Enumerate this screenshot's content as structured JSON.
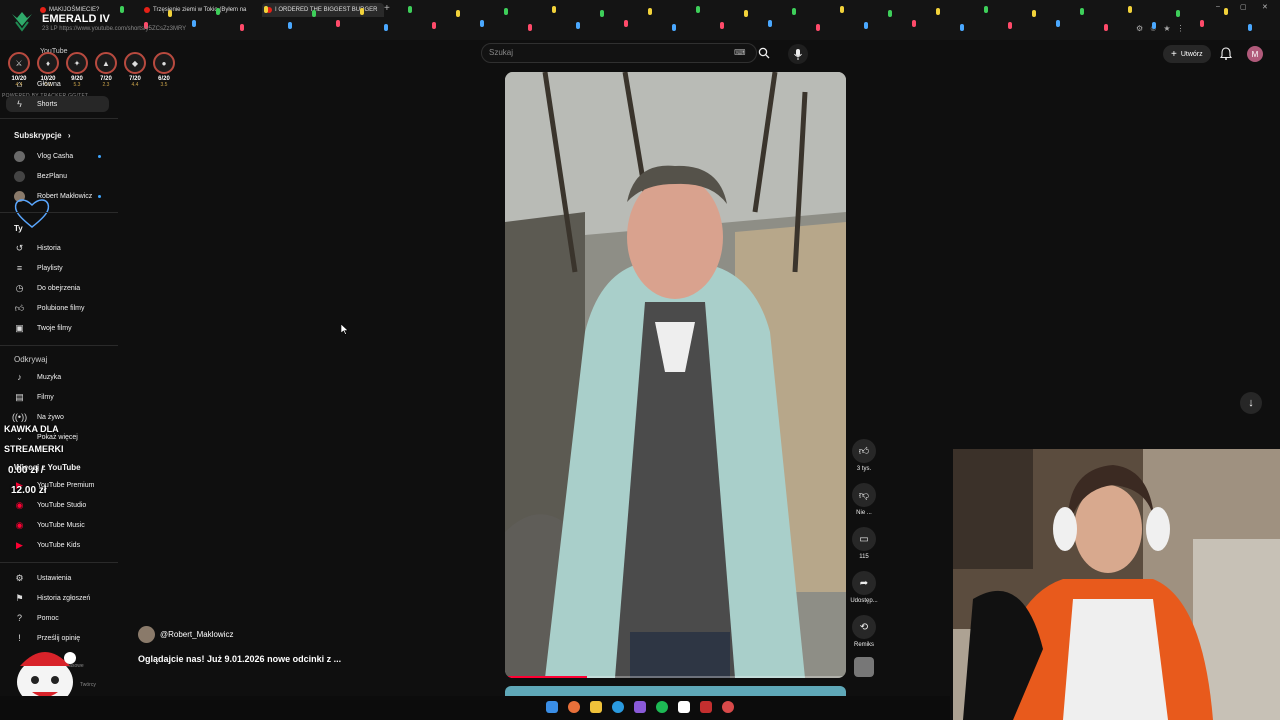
{
  "browser": {
    "tabs": [
      {
        "label": "MAKIJOŚMIECIE?"
      },
      {
        "label": "Trzęsienie ziemi w Tokio (Byłem na"
      },
      {
        "label": "I ORDERED THE BIGGEST BURGER"
      }
    ],
    "new_tab": "+",
    "address": "https://www.youtube.com/shorts/y5ZCsZz3MRY",
    "window_controls": [
      "–",
      "▢",
      "✕"
    ]
  },
  "overlay": {
    "rank_title": "EMERALD IV",
    "subtitle": "23 LP",
    "traits": [
      {
        "count": "10/20",
        "value": "4.4"
      },
      {
        "count": "10/20",
        "value": "5.2"
      },
      {
        "count": "9/20",
        "value": "5.3"
      },
      {
        "count": "7/20",
        "value": "2.3"
      },
      {
        "count": "7/20",
        "value": "4.4"
      },
      {
        "count": "6/20",
        "value": "3.5"
      }
    ],
    "powered_by": "POWERED BY TRACKER.GG/TFT",
    "kawka_line1": "KAWKA DLA",
    "kawka_line2": "STREAMERKI",
    "kawka_current": "0.00 zł /",
    "kawka_goal": "12.00 zł"
  },
  "header": {
    "logo_text": "YouTube",
    "search_placeholder": "Szukaj",
    "create_label": "Utwórz",
    "avatar_letter": "M"
  },
  "sidebar": {
    "top_items": [
      {
        "label": "Główna"
      },
      {
        "label": "Shorts"
      }
    ],
    "subscriptions_title": "Subskrypcje",
    "subscriptions": [
      {
        "label": "Vlog Casha"
      },
      {
        "label": "BezPlanu"
      },
      {
        "label": "Robert Makłowicz"
      }
    ],
    "you_title": "Ty",
    "you_items": [
      {
        "label": "Historia"
      },
      {
        "label": "Playlisty"
      },
      {
        "label": "Do obejrzenia"
      },
      {
        "label": "Polubione filmy"
      },
      {
        "label": "Twoje filmy"
      }
    ],
    "explore_title": "Odkrywaj",
    "explore_items": [
      {
        "label": "Muzyka"
      },
      {
        "label": "Filmy"
      },
      {
        "label": "Na żywo"
      },
      {
        "label": "Pokaż więcej"
      }
    ],
    "more_title": "Więcej z YouTube",
    "more_items": [
      {
        "label": "YouTube Premium"
      },
      {
        "label": "YouTube Studio"
      },
      {
        "label": "YouTube Music"
      },
      {
        "label": "YouTube Kids"
      }
    ],
    "bottom_items": [
      {
        "label": "Ustawienia"
      },
      {
        "label": "Historia zgłoszeń"
      },
      {
        "label": "Pomoc"
      },
      {
        "label": "Prześlij opinię"
      }
    ],
    "footer_text": "Informacje prasowe",
    "footer_text2": "Twórcy"
  },
  "short": {
    "channel": "@Robert_Maklowicz",
    "caption": "Oglądajcie nas! Już 9.01.2026 nowe odcinki z ...",
    "progress": 0.24,
    "actions": [
      {
        "icon": "thumb-up-icon",
        "label": "3 tys."
      },
      {
        "icon": "thumb-down-icon",
        "label": "Nie ..."
      },
      {
        "icon": "comment-icon",
        "label": "115"
      },
      {
        "icon": "share-icon",
        "label": "Udostęp..."
      },
      {
        "icon": "remix-icon",
        "label": "Remiks"
      }
    ]
  },
  "colors": {
    "background": "#0f0f0f",
    "accent": "#ff0033",
    "rank_ring": "#b84a3f"
  }
}
